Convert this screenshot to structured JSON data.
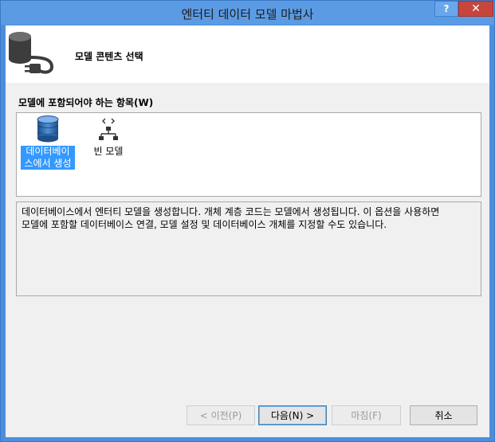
{
  "window": {
    "title": "엔터티 데이터 모델 마법사"
  },
  "titlebar": {
    "help_label": "?",
    "close_label": "✕"
  },
  "header": {
    "title": "모델 콘텐츠 선택",
    "icon": "database-plug-icon"
  },
  "content": {
    "section_label": "모델에 포함되어야 하는 항목(W)",
    "items": [
      {
        "label": "데이터베이\n스에서 생성",
        "icon": "database-icon",
        "selected": true
      },
      {
        "label": "빈 모델",
        "icon": "empty-model-icon",
        "selected": false
      }
    ],
    "description": "데이터베이스에서 엔터티 모델을 생성합니다. 개체 계층 코드는 모델에서 생성됩니다. 이 옵션을 사용하면\n모델에 포함할 데이터베이스 연결, 모델 설정 및 데이터베이스 개체를 지정할 수도 있습니다."
  },
  "buttons": {
    "prev": "< 이전(P)",
    "next": "다음(N) >",
    "finish": "마침(F)",
    "cancel": "취소"
  },
  "colors": {
    "selection": "#3399ff",
    "titlebar": "#5b9be4",
    "close": "#c7463c"
  }
}
